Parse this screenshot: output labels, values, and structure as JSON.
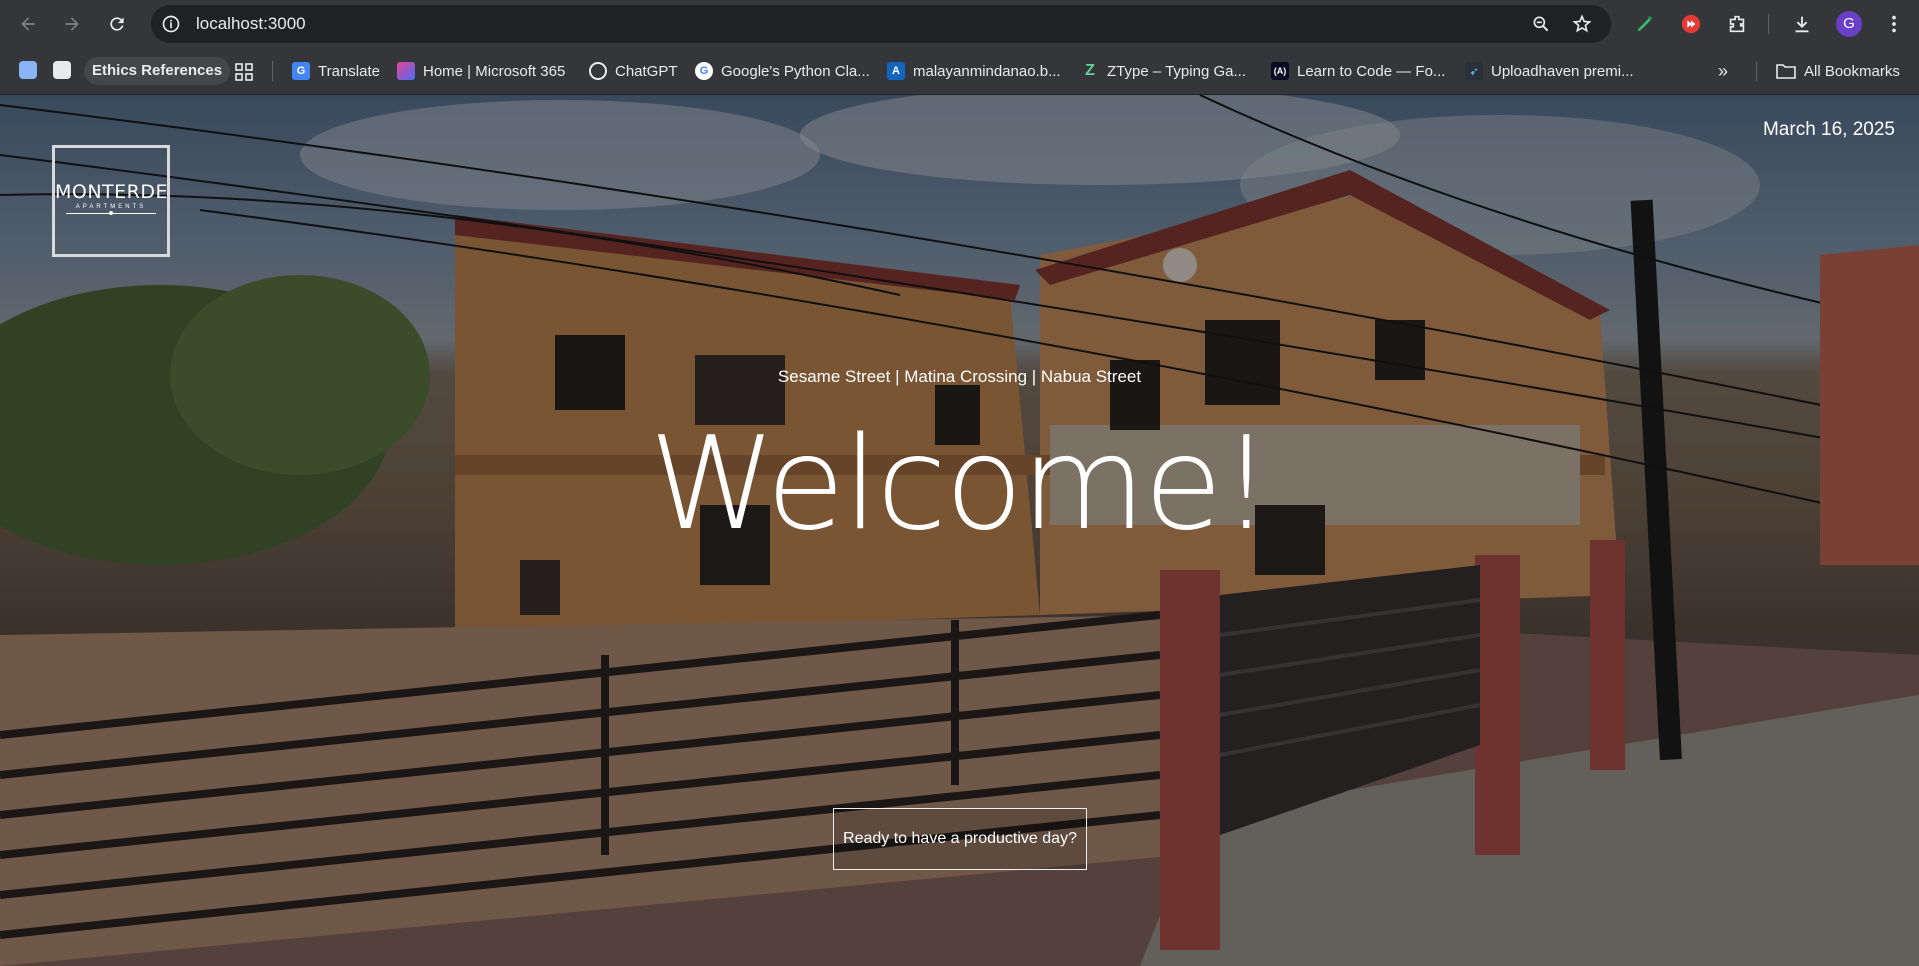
{
  "browser": {
    "url": "localhost:3000",
    "avatar_letter": "G",
    "toolbar_icons": [
      "back-icon",
      "forward-icon",
      "reload-icon",
      "site-info-icon",
      "zoom-icon",
      "star-icon",
      "pen-extension-icon",
      "youtube-extension-icon",
      "puzzle-icon",
      "download-icon",
      "menu-icon"
    ]
  },
  "bookmarks": {
    "folder_chip": "Ethics References",
    "items": [
      {
        "label": "Translate",
        "icon": "google-translate-icon"
      },
      {
        "label": "Home | Microsoft 365",
        "icon": "microsoft365-icon"
      },
      {
        "label": "ChatGPT",
        "icon": "chatgpt-icon"
      },
      {
        "label": "Google's Python Cla...",
        "icon": "google-icon"
      },
      {
        "label": "malayanmindanao.b...",
        "icon": "malayan-icon"
      },
      {
        "label": "ZType – Typing Ga...",
        "icon": "ztype-icon"
      },
      {
        "label": "Learn to Code — Fo...",
        "icon": "freecodecamp-icon"
      },
      {
        "label": "Uploadhaven premi...",
        "icon": "uploadhaven-icon"
      }
    ],
    "all_bookmarks": "All Bookmarks"
  },
  "page": {
    "logo": {
      "name": "MONTERDE",
      "sub": "APARTMENTS"
    },
    "date": "March 16, 2025",
    "streets": "Sesame Street | Matina Crossing | Nabua Street",
    "welcome": "Welcome!",
    "cta": "Ready to have a productive day?"
  },
  "colors": {
    "toolbar": "#353639",
    "omnibox": "#202124",
    "accent": "#ffffff"
  }
}
